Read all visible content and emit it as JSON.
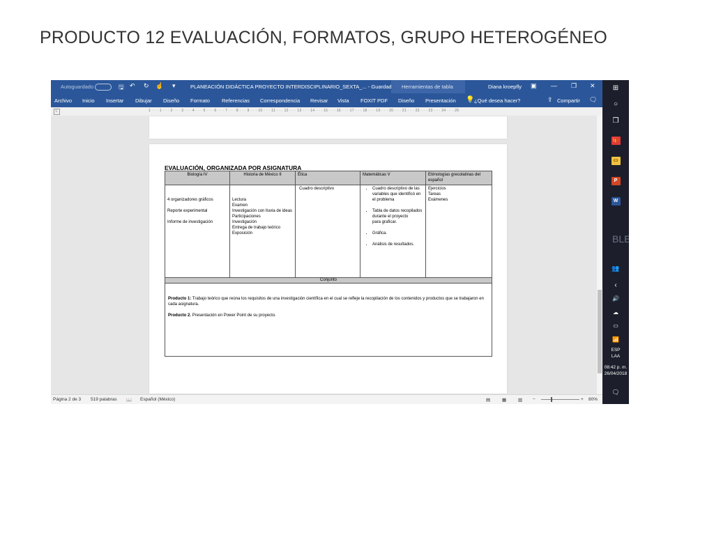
{
  "slide": {
    "title": "PRODUCTO 12 EVALUACIÓN, FORMATOS, GRUPO HETEROGÉNEO"
  },
  "word": {
    "autosave_label": "Autoguardado",
    "document_title": "PLANEACIÓN DIDÁCTICA PROYECTO INTERDISCIPLINARIO_SEXTA_...  -  Guardado",
    "contextual_tab": "Herramientas de tabla",
    "user_name": "Diana kroepfly",
    "ribbon_tabs": [
      "Archivo",
      "Inicio",
      "Insertar",
      "Dibujar",
      "Diseño",
      "Formato",
      "Referencias",
      "Correspondencia",
      "Revisar",
      "Vista",
      "FOXIT PDF",
      "Diseño",
      "Presentación"
    ],
    "search_placeholder": "¿Qué desea hacer?",
    "share_label": "Compartir",
    "ruler_marks": "1 · · · 1 · · · 2 · · · 3 · · · 4 · · · 5 · · · 6 · · · 7 · · · 8 · · · 9 · · · 10 · · · 11 · · · 12 · · · 13 · · · 14 · · · 15 · · · 16 · · · 17 · · · 18 · · · 19 · · · 20 · · · 21 · · · 22 · · · 23 · · · 24 · · · 26",
    "ruler_corner": "L"
  },
  "document": {
    "heading": "EVALUACIÓN, ORGANIZADA POR ASIGNATURA",
    "headers": [
      "Biología IV",
      "Historia de México II",
      "Ética",
      "Matemáticas V",
      "Etimologías grecolatinas del español"
    ],
    "biologia": [
      "4 organizadores gráficos",
      "Reporte experimental",
      "Informe de investigación"
    ],
    "historia": [
      "Lectura",
      "Examen",
      "Investigación con lluvia de ideas",
      "Participaciones",
      "Investigación",
      "Entrega de trabajo teórico",
      "Exposición"
    ],
    "etica": [
      "Cuadro descriptivo"
    ],
    "matematicas": [
      "Cuadro descriptivo de las variables que identificó en el problema",
      "Tabla de datos recopilados durante el proyecto",
      "para graficar.",
      "Gráfica.",
      "Análisis de resultados."
    ],
    "etimologias": [
      "Ejercicios",
      "Tareas",
      "Exámenes"
    ],
    "conjunto_label": "Conjunto",
    "producto1_label": "Producto 1:",
    "producto1_text": "Trabajo teórico que reúna los requisitos de una investigación científica en el cual se refleje la recopilación de los contenidos y productos que se trabajaron en cada asignatura.",
    "producto2_label": "Producto 2.",
    "producto2_text": "Presentación en Power Point de su proyecto."
  },
  "status": {
    "page": "Página 2 de 3",
    "words": "519 palabras",
    "language": "Español (México)",
    "zoom": "80%"
  },
  "taskbar": {
    "lang_code": "ESP",
    "lang_region": "LAA",
    "time": "08:42 p. m.",
    "date": "26/04/2018",
    "bg_text": "BLE"
  }
}
